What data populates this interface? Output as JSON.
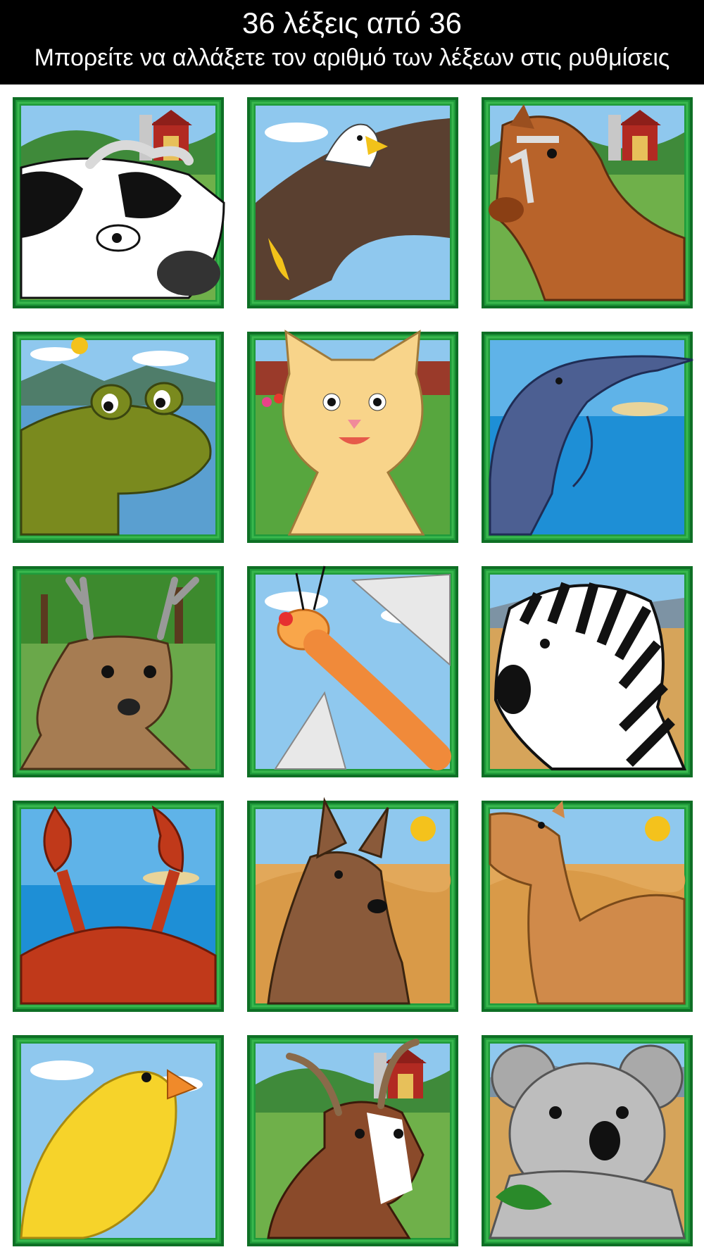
{
  "header": {
    "title": "36 λέξεις από 36",
    "subtitle": "Μπορείτε να αλλάξετε τον αριθμό των λέξεων στις ρυθμίσεις"
  },
  "tiles": [
    {
      "animal": "cow",
      "scene": "farm"
    },
    {
      "animal": "eagle",
      "scene": "sky"
    },
    {
      "animal": "horse",
      "scene": "farm"
    },
    {
      "animal": "frog",
      "scene": "lake"
    },
    {
      "animal": "cat",
      "scene": "garden"
    },
    {
      "animal": "dolphin",
      "scene": "sea"
    },
    {
      "animal": "deer",
      "scene": "forest"
    },
    {
      "animal": "dragonfly",
      "scene": "sky"
    },
    {
      "animal": "zebra",
      "scene": "savanna"
    },
    {
      "animal": "crab",
      "scene": "sea"
    },
    {
      "animal": "kangaroo",
      "scene": "desert"
    },
    {
      "animal": "camel",
      "scene": "desert"
    },
    {
      "animal": "canary",
      "scene": "sky"
    },
    {
      "animal": "goat",
      "scene": "farm"
    },
    {
      "animal": "koala",
      "scene": "savanna"
    }
  ],
  "colors": {
    "frame": "#1f9a3a",
    "frameLight": "#39b84e",
    "frameDark": "#0e6f25",
    "sky": "#8fc8ee",
    "grass": "#6fb04a",
    "sea": "#1e8fd6",
    "sand": "#e2a85a",
    "savanna": "#d6a45a"
  }
}
